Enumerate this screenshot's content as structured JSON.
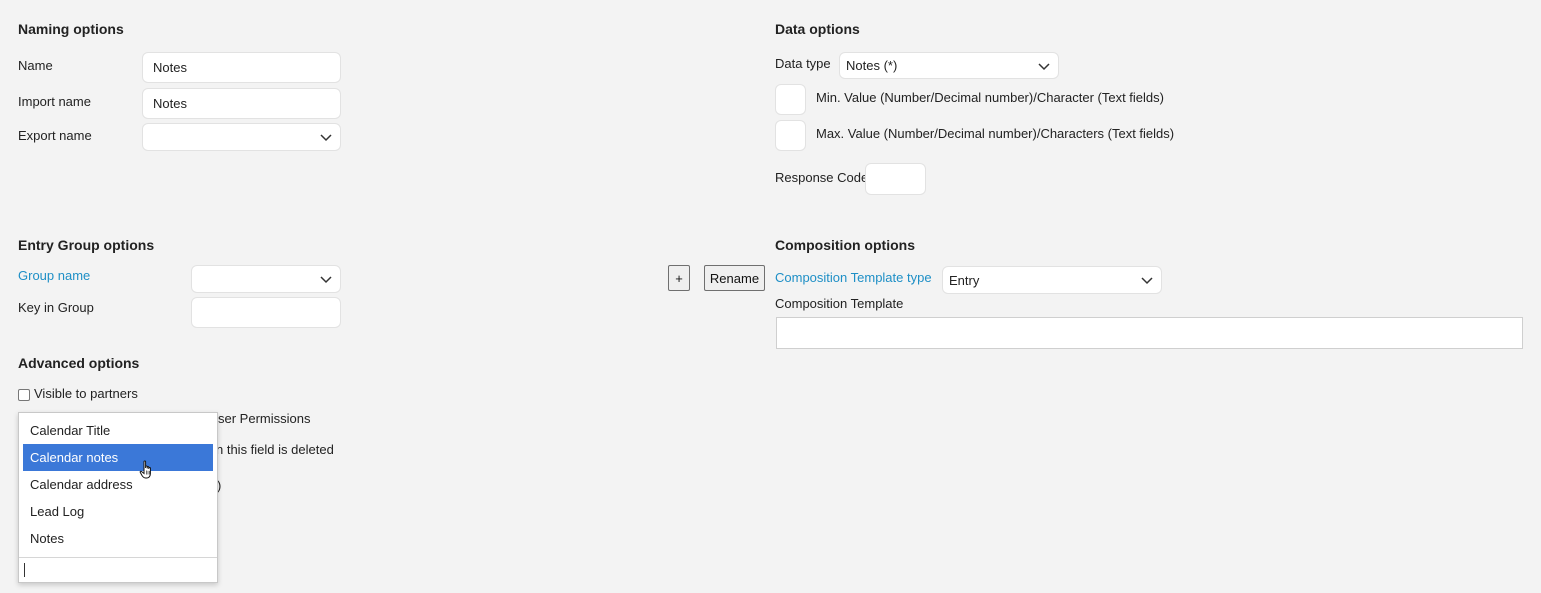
{
  "naming": {
    "heading": "Naming options",
    "name_label": "Name",
    "name_value": "Notes",
    "import_label": "Import name",
    "import_value": "Notes",
    "export_label": "Export name",
    "export_value": ""
  },
  "data_options": {
    "heading": "Data options",
    "data_type_label": "Data type",
    "data_type_value": "Notes (*)",
    "min_label": "Min. Value (Number/Decimal number)/Character (Text fields)",
    "max_label": "Max. Value (Number/Decimal number)/Characters (Text fields)",
    "response_code_label": "Response Code"
  },
  "entry_group": {
    "heading": "Entry Group options",
    "group_name_label": "Group name",
    "group_name_value": "",
    "key_label": "Key in Group",
    "add_button": "+",
    "rename_button": "Rename"
  },
  "composition": {
    "heading": "Composition options",
    "template_type_label": "Composition Template type",
    "template_type_value": "Entry",
    "template_label": "Composition Template"
  },
  "advanced": {
    "heading": "Advanced options",
    "visible_partners_label": "Visible to partners",
    "partial_1": "ser Permissions",
    "partial_2": "n this field is deleted",
    "partial_3": ")"
  },
  "export_dropdown": {
    "options": [
      "Calendar Title",
      "Calendar notes",
      "Calendar address",
      "Lead Log",
      "Notes"
    ],
    "selected_index": 1,
    "search_value": ""
  },
  "colors": {
    "accent_link": "#1e8fc6",
    "selection": "#3b78d8",
    "background": "#f3f3f3"
  }
}
